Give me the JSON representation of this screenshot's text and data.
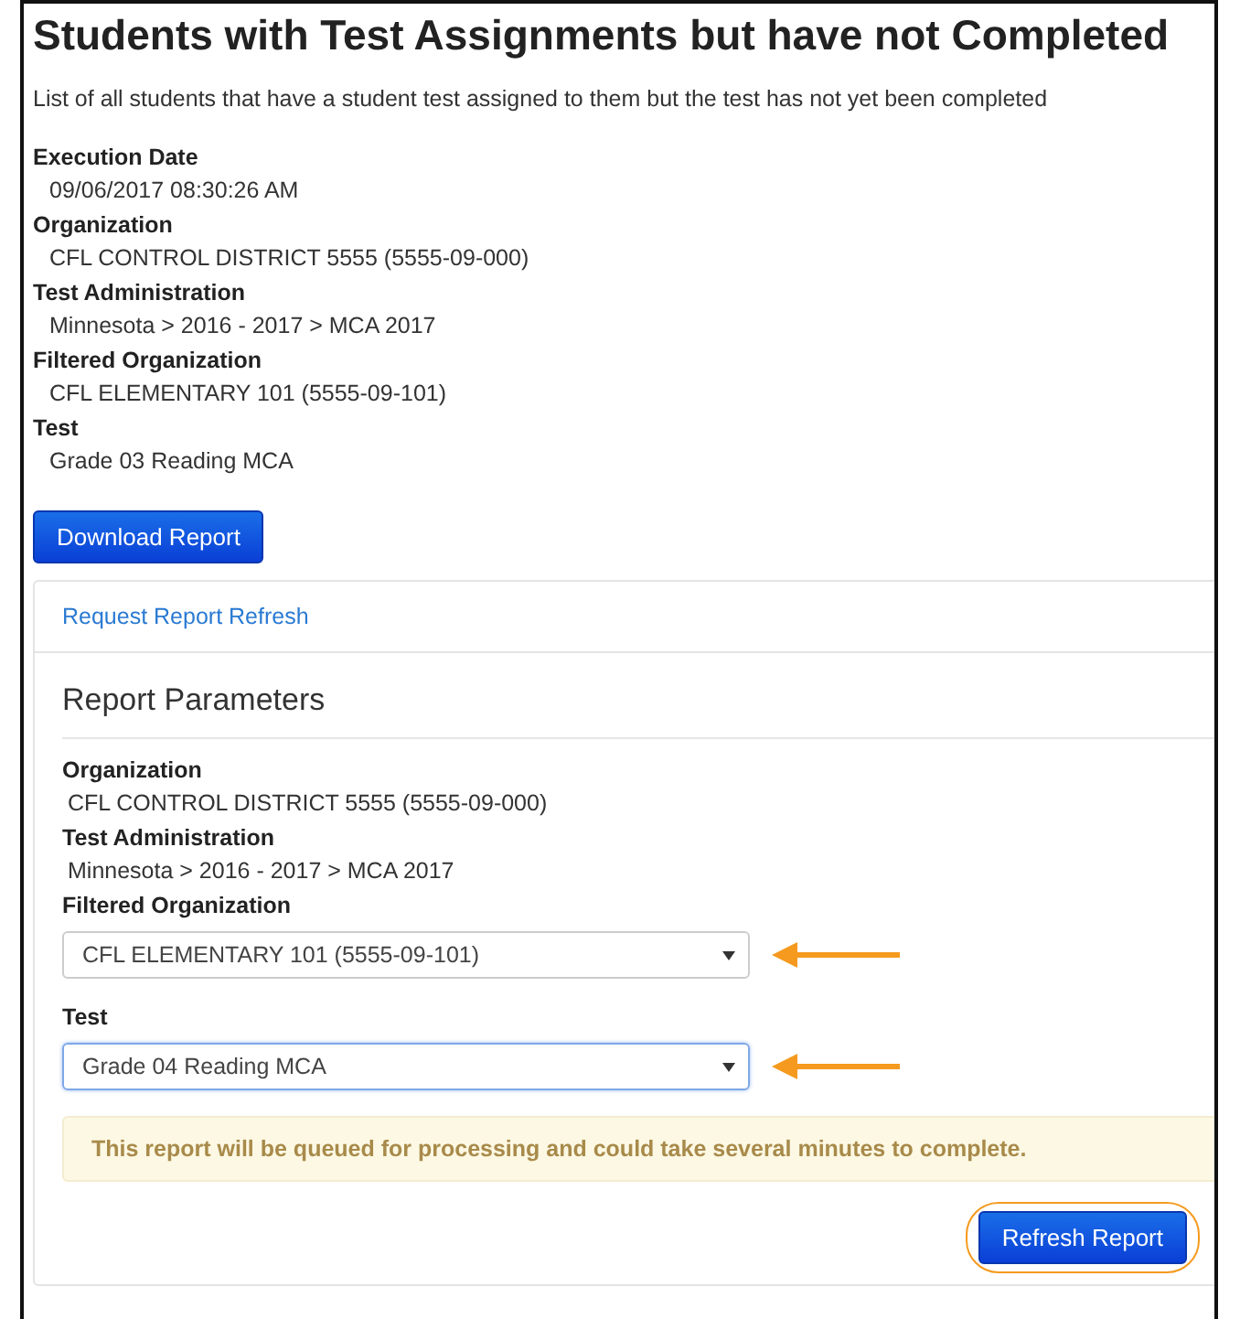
{
  "title": "Students with Test Assignments but have not Completed",
  "description": "List of all students that have a student test assigned to them but the test has not yet been completed",
  "fields": [
    {
      "label": "Execution Date",
      "value": "09/06/2017 08:30:26 AM"
    },
    {
      "label": "Organization",
      "value": "CFL CONTROL DISTRICT 5555 (5555-09-000)"
    },
    {
      "label": "Test Administration",
      "value": "Minnesota > 2016 - 2017 > MCA 2017"
    },
    {
      "label": "Filtered Organization",
      "value": "CFL ELEMENTARY 101 (5555-09-101)"
    },
    {
      "label": "Test",
      "value": "Grade 03 Reading MCA"
    }
  ],
  "download_button": "Download Report",
  "panel": {
    "link": "Request Report Refresh",
    "heading": "Report Parameters",
    "fields": [
      {
        "label": "Organization",
        "value": "CFL CONTROL DISTRICT 5555 (5555-09-000)"
      },
      {
        "label": "Test Administration",
        "value": "Minnesota > 2016 - 2017 > MCA 2017"
      }
    ],
    "selects": [
      {
        "label": "Filtered Organization",
        "value": "CFL ELEMENTARY 101 (5555-09-101)",
        "focused": false,
        "annotated": true
      },
      {
        "label": "Test",
        "value": "Grade 04 Reading MCA",
        "focused": true,
        "annotated": true
      }
    ],
    "notice": "This report will be queued for processing and could take several minutes to complete.",
    "refresh_button": "Refresh Report",
    "refresh_circled": true
  }
}
